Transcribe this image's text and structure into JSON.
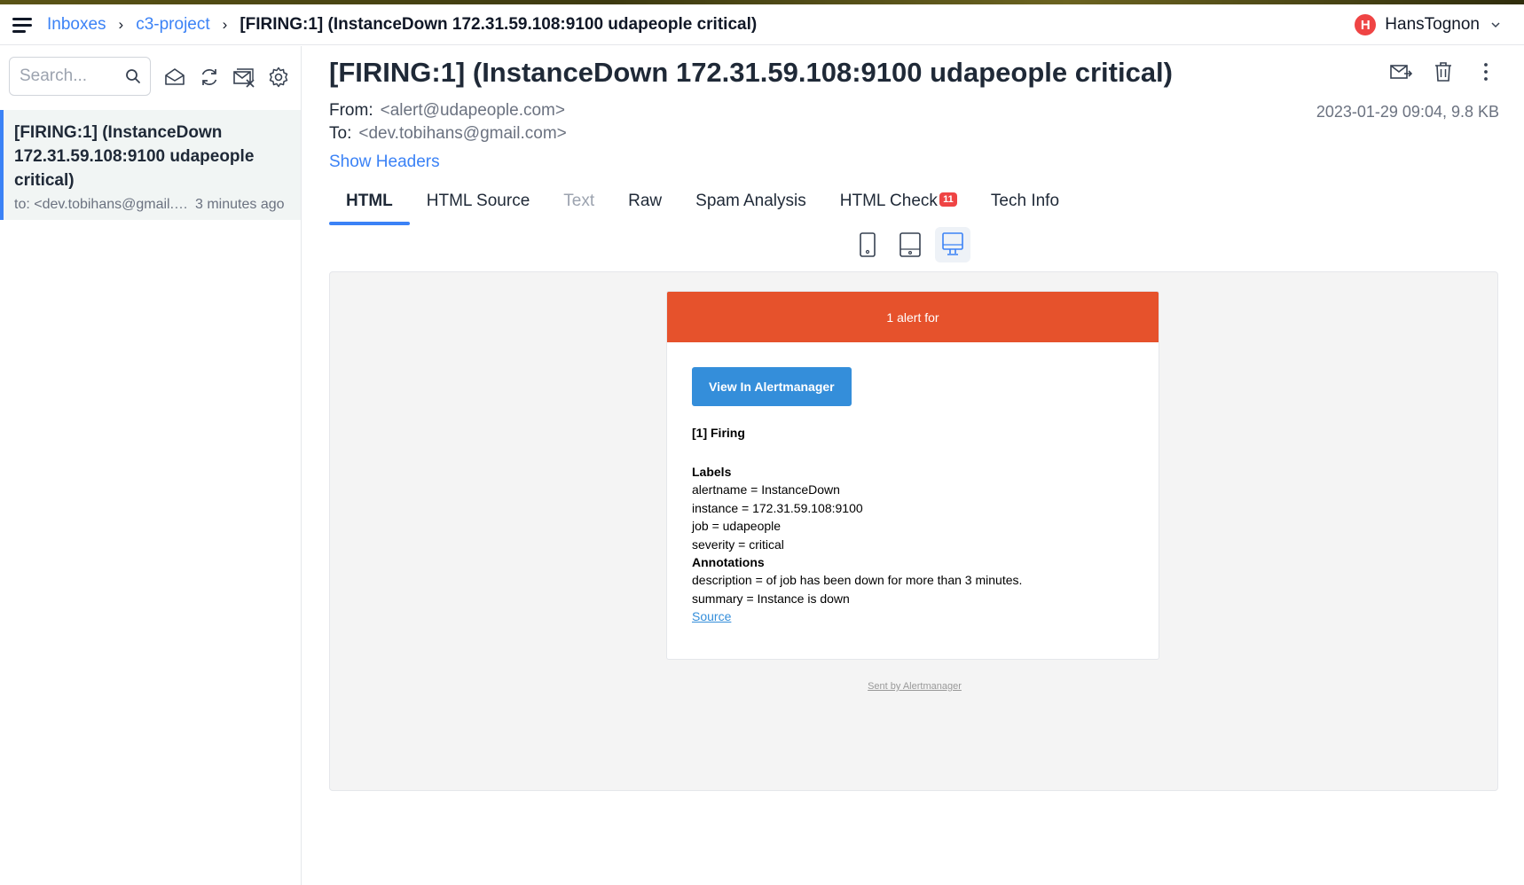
{
  "breadcrumb": {
    "items": [
      "Inboxes",
      "c3-project"
    ],
    "current": "[FIRING:1] (InstanceDown 172.31.59.108:9100 udapeople critical)"
  },
  "user": {
    "initial": "H",
    "name": "HansTognon"
  },
  "sidebar": {
    "search": {
      "placeholder": "Search...",
      "value": ""
    },
    "messages": [
      {
        "subject": "[FIRING:1] (InstanceDown 172.31.59.108:9100 udapeople critical)",
        "to": "to: <dev.tobihans@gmail.com>",
        "time": "3 minutes ago"
      }
    ]
  },
  "email": {
    "subject": "[FIRING:1] (InstanceDown 172.31.59.108:9100 udapeople critical)",
    "from_label": "From:",
    "from": "<alert@udapeople.com>",
    "to_label": "To:",
    "to": "<dev.tobihans@gmail.com>",
    "meta": "2023-01-29 09:04, 9.8 KB",
    "show_headers": "Show Headers"
  },
  "tabs": [
    {
      "label": "HTML",
      "state": "active"
    },
    {
      "label": "HTML Source",
      "state": "normal"
    },
    {
      "label": "Text",
      "state": "disabled"
    },
    {
      "label": "Raw",
      "state": "normal"
    },
    {
      "label": "Spam Analysis",
      "state": "normal"
    },
    {
      "label": "HTML Check",
      "state": "normal",
      "badge": "11"
    },
    {
      "label": "Tech Info",
      "state": "normal"
    }
  ],
  "preview": {
    "header": "1 alert for",
    "button": "View In Alertmanager",
    "firing": "[1] Firing",
    "labels_heading": "Labels",
    "labels": [
      "alertname = InstanceDown",
      "instance = 172.31.59.108:9100",
      "job = udapeople",
      "severity = critical"
    ],
    "annotations_heading": "Annotations",
    "annotations": [
      "description = of job has been down for more than 3 minutes.",
      "summary = Instance is down"
    ],
    "source_link": "Source",
    "footer": "Sent by Alertmanager"
  },
  "colors": {
    "accent": "#3b82f6",
    "alert_header": "#e6522c",
    "alertmanager_button": "#348eda",
    "badge": "#ef4444"
  },
  "icons": {
    "actions": [
      "forward-mail-icon",
      "trash-icon",
      "more-vertical-icon"
    ],
    "sidebar_tools": [
      "mark-read-icon",
      "refresh-icon",
      "delete-all-icon",
      "settings-icon"
    ],
    "devices": [
      "phone-icon",
      "tablet-icon",
      "desktop-icon"
    ]
  }
}
